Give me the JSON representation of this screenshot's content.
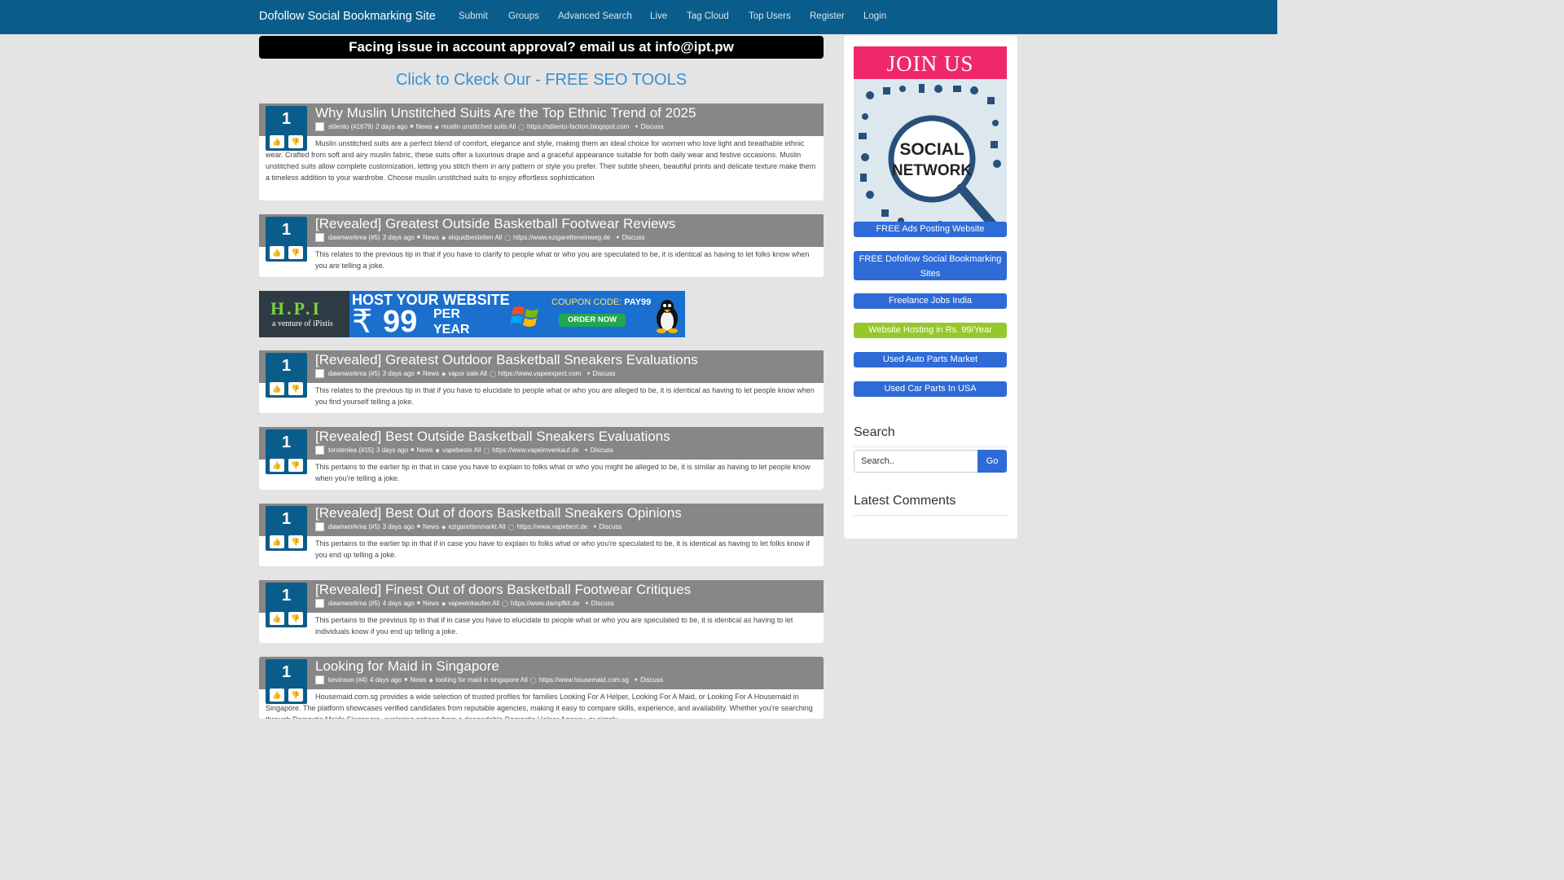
{
  "nav": {
    "brand": "Dofollow Social Bookmarking Site",
    "links": [
      "Submit",
      "Groups",
      "Advanced Search",
      "Live",
      "Tag Cloud",
      "Top Users",
      "Register",
      "Login"
    ]
  },
  "notice": "Facing issue in account approval? email us at info@ipt.pw",
  "seo_link": "Click to Ckeck Our - FREE SEO TOOLS",
  "stories": [
    {
      "votes": "1",
      "title": "Why Muslin Unstitched Suits Are the Top Ethnic Trend of 2025",
      "author": "stilento (#1679)",
      "time": "2 days ago",
      "category": "News",
      "tags": "muslin unstitched suits All",
      "url": "https://stilento-faction.blogspot.com",
      "discuss": "Discuss",
      "description": "Muslin unstitched suits are a perfect blend of comfort, elegance and style, making them an ideal choice for women who love light and breathable ethnic wear. Crafted from soft and airy muslin fabric, these suits offer a luxurious drape and a graceful appearance suitable for both daily wear and festive occasions. Muslin unstitched suits allow complete customization, letting you stitch them in any pattern or style you prefer. Their subtle sheen, beautiful prints and delicate texture make them a timeless addition to your wardrobe. Choose muslin unstitched suits to enjoy effortless sophistication"
    },
    {
      "votes": "1",
      "title": "[Revealed] Greatest Outside Basketball Footwear Reviews",
      "author": "dawnworkma (#5)",
      "time": "3 days ago",
      "category": "News",
      "tags": "eliquidbestellen All",
      "url": "https://www.ezigaretteneinweg.de",
      "discuss": "Discuss",
      "description": "This relates to the previous tip in that if you have to clarify to people what or who you are speculated to be, it is identical as having to let folks know when you are telling a joke."
    },
    {
      "votes": "1",
      "title": "[Revealed] Greatest Outdoor Basketball Sneakers Evaluations",
      "author": "dawnworkma (#5)",
      "time": "3 days ago",
      "category": "News",
      "tags": "vapor sale All",
      "url": "https://www.vapeexpect.com",
      "discuss": "Discuss",
      "description": "This relates to the previous tip in that if you have to elucidate to people what or who you are alleged to be, it is identical as having to let people know when you find yourself telling a joke."
    },
    {
      "votes": "1",
      "title": "[Revealed] Best Outside Basketball Sneakers Evaluations",
      "author": "torstenlea (#15)",
      "time": "3 days ago",
      "category": "News",
      "tags": "vapebeste All",
      "url": "https://www.vapeimverkauf.de",
      "discuss": "Discuss",
      "description": "This pertains to the earlier tip in that in case you have to explain to folks what or who you might be alleged to be, it is similar as having to let people know when you're telling a joke."
    },
    {
      "votes": "1",
      "title": "[Revealed] Best Out of doors Basketball Sneakers Opinions",
      "author": "dawnworkma (#5)",
      "time": "3 days ago",
      "category": "News",
      "tags": "ezigarettenmarkt All",
      "url": "https://www.vapebest.de",
      "discuss": "Discuss",
      "description": "This pertains to the earlier tip in that if in case you have to explain to folks what or who you're speculated to be, it is identical as having to let folks know if you end up telling a joke."
    },
    {
      "votes": "1",
      "title": "[Revealed] Finest Out of doors Basketball Footwear Critiques",
      "author": "dawnworkma (#5)",
      "time": "4 days ago",
      "category": "News",
      "tags": "vapeeinkaufen All",
      "url": "https://www.dampfkit.de",
      "discuss": "Discuss",
      "description": "This pertains to the previous tip in that if in case you have to elucidate to people what or who you are speculated to be, it is identical as having to let individuals know if you end up telling a joke."
    },
    {
      "votes": "1",
      "title": "Looking for Maid in Singapore",
      "author": "kevinson (#4)",
      "time": "4 days ago",
      "category": "News",
      "tags": "looking for maid in singapore All",
      "url": "https://www.housemaid.com.sg",
      "discuss": "Discuss",
      "description": "Housemaid.com.sg provides a wide selection of trusted profiles for families Looking For A Helper, Looking For A Maid, or Looking For A Housemaid in Singapore. The platform showcases verified candidates from reputable agencies, making it easy to compare skills, experience, and availability. Whether you're searching through Domestic Maids Singapore, exploring options from a dependable Domestic Helper Agency, or simply"
    }
  ],
  "banner": {
    "logo": "H.P.I",
    "logo_sub": "a venture of iPistis",
    "headline": "HOST YOUR WEBSITE",
    "currency": "₹",
    "price": "99",
    "per_1": "PER",
    "per_2": "YEAR",
    "coupon_label": "COUPON CODE:",
    "coupon_code": "PAY99",
    "order_label": "ORDER NOW"
  },
  "sidebar": {
    "join_title": "JOIN US",
    "join_art_line1": "SOCIAL",
    "join_art_line2": "NETWORK",
    "buttons": [
      "FREE Ads Posting Website",
      "FREE Dofollow Social Bookmarking Sites",
      "Freelance Jobs India",
      "Website Hosting in Rs. 99/Year",
      "Used Auto Parts Market",
      "Used Car Parts In USA"
    ],
    "search_heading": "Search",
    "search_placeholder": "Search..",
    "search_go": "Go",
    "comments_heading": "Latest Comments"
  },
  "colors": {
    "navbar": "#0a5d8a",
    "story_header": "#878787",
    "vote_box": "#0a5d8a",
    "sidebar_button": "#2f6bd7",
    "sidebar_button_alt": "#95c82a",
    "join_banner": "#f0286b",
    "seo_link": "#3a8fcf"
  }
}
